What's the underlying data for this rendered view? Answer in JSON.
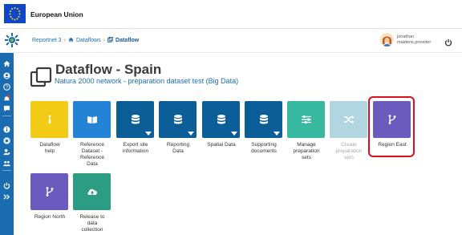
{
  "eu_bar": {
    "title": "European Union"
  },
  "breadcrumb": {
    "item1": "Reportnet 3",
    "item2": "Dataflows",
    "item3": "Dataflow"
  },
  "user": {
    "line1": "jonathan",
    "line2": "maidens.provider"
  },
  "page": {
    "title": "Dataflow - Spain",
    "subtitle": "Natura 2000 network - preparation dataset test (Big Data)"
  },
  "colors": {
    "eu_blue": "#0e47cb",
    "sidebar": "#1a6bb0",
    "yellow": "#f2cb17",
    "blue_light": "#2483d4",
    "blue_dark": "#0b5e98",
    "teal": "#37b9a0",
    "teal_disabled": "#b2d6df",
    "purple": "#6c5bbf",
    "green": "#2c9d83",
    "highlight": "#d8101d"
  },
  "tiles": [
    {
      "label": "Dataflow\nhelp",
      "icon": "info-icon"
    },
    {
      "label": "Reference\nDataset -\nReference\nData",
      "icon": "book-icon"
    },
    {
      "label": "Export site\ninformation",
      "icon": "database-icon"
    },
    {
      "label": "Reporting\nData",
      "icon": "database-icon"
    },
    {
      "label": "Spatial Data",
      "icon": "database-icon"
    },
    {
      "label": "Supporting\ndocuments",
      "icon": "database-icon"
    },
    {
      "label": "Manage\npreparation\nsets",
      "icon": "sliders-icon"
    },
    {
      "label": "Create\npreparation\nsets",
      "icon": "shuffle-icon"
    },
    {
      "label": "Region East",
      "icon": "branch-icon"
    },
    {
      "label": "Region North",
      "icon": "branch-icon"
    },
    {
      "label": "Release to\ndata\ncollection",
      "icon": "cloud-upload-icon"
    }
  ]
}
